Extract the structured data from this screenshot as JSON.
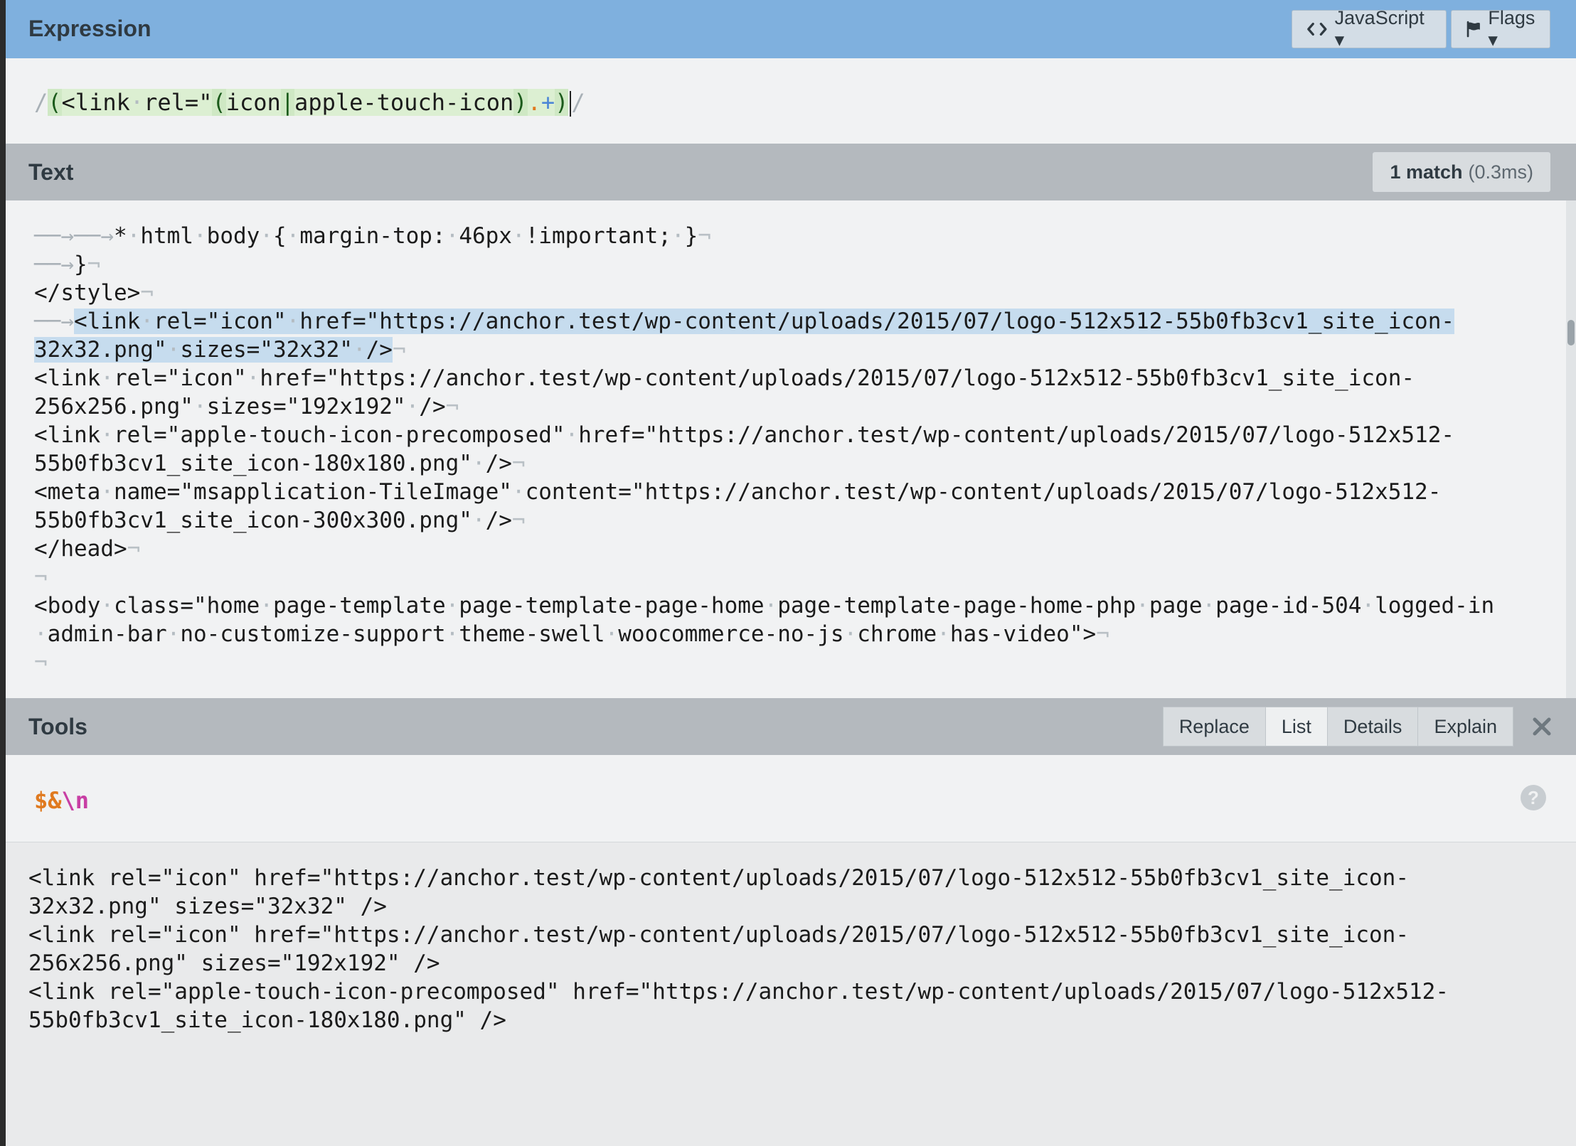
{
  "expression": {
    "title": "Expression",
    "flavor_label": "JavaScript ▾",
    "flags_label": "Flags ▾",
    "delim_open": "/",
    "delim_close": "/",
    "parts": {
      "paren_open": "(",
      "link": "<link",
      "rel": "rel=\"",
      "alt_open": "(",
      "alt1": "icon",
      "pipe": "|",
      "alt2": "apple-touch-icon",
      "alt_close": ")",
      "dot": ".",
      "plus": "+",
      "paren_close": ")"
    }
  },
  "text": {
    "title": "Text",
    "match_count": "1 match",
    "match_time": "(0.3ms)",
    "lines": [
      "* html body { margin-top: 46px !important; }",
      "}",
      "</style>",
      "<link rel=\"icon\" href=\"https://anchor.test/wp-content/uploads/2015/07/logo-512x512-55b0fb3cv1_site_icon-",
      "32x32.png\" sizes=\"32x32\" />",
      "<link rel=\"icon\" href=\"https://anchor.test/wp-content/uploads/2015/07/logo-512x512-55b0fb3cv1_site_icon-",
      "256x256.png\" sizes=\"192x192\" />",
      "<link rel=\"apple-touch-icon-precomposed\" href=\"https://anchor.test/wp-content/uploads/2015/07/logo-512x512-",
      "55b0fb3cv1_site_icon-180x180.png\" />",
      "<meta name=\"msapplication-TileImage\" content=\"https://anchor.test/wp-content/uploads/2015/07/logo-512x512-",
      "55b0fb3cv1_site_icon-300x300.png\" />",
      "</head>",
      "",
      "<body class=\"home page-template page-template-page-home page-template-page-home-php page page-id-504 logged-in",
      "admin-bar no-customize-support theme-swell woocommerce-no-js chrome has-video\">",
      ""
    ]
  },
  "tools": {
    "title": "Tools",
    "tabs": [
      "Replace",
      "List",
      "Details",
      "Explain"
    ],
    "active_tab": "List",
    "substitution": {
      "part1": "$&",
      "part2": "\\n"
    },
    "help_label": "?",
    "output_lines": [
      "<link rel=\"icon\" href=\"https://anchor.test/wp-content/uploads/2015/07/logo-512x512-55b0fb3cv1_site_icon-",
      "32x32.png\" sizes=\"32x32\" />",
      "<link rel=\"icon\" href=\"https://anchor.test/wp-content/uploads/2015/07/logo-512x512-55b0fb3cv1_site_icon-",
      "256x256.png\" sizes=\"192x192\" />",
      "<link rel=\"apple-touch-icon-precomposed\" href=\"https://anchor.test/wp-content/uploads/2015/07/logo-512x512-",
      "55b0fb3cv1_site_icon-180x180.png\" />"
    ]
  },
  "colors": {
    "header_blue": "#7fb0de",
    "section_gray": "#b4b9be",
    "match_highlight": "#c6dcee",
    "group_green": "#cfe8c4"
  },
  "icons": {
    "code": "code-icon",
    "flag": "flag-icon",
    "close": "close-icon",
    "help": "help-icon"
  }
}
